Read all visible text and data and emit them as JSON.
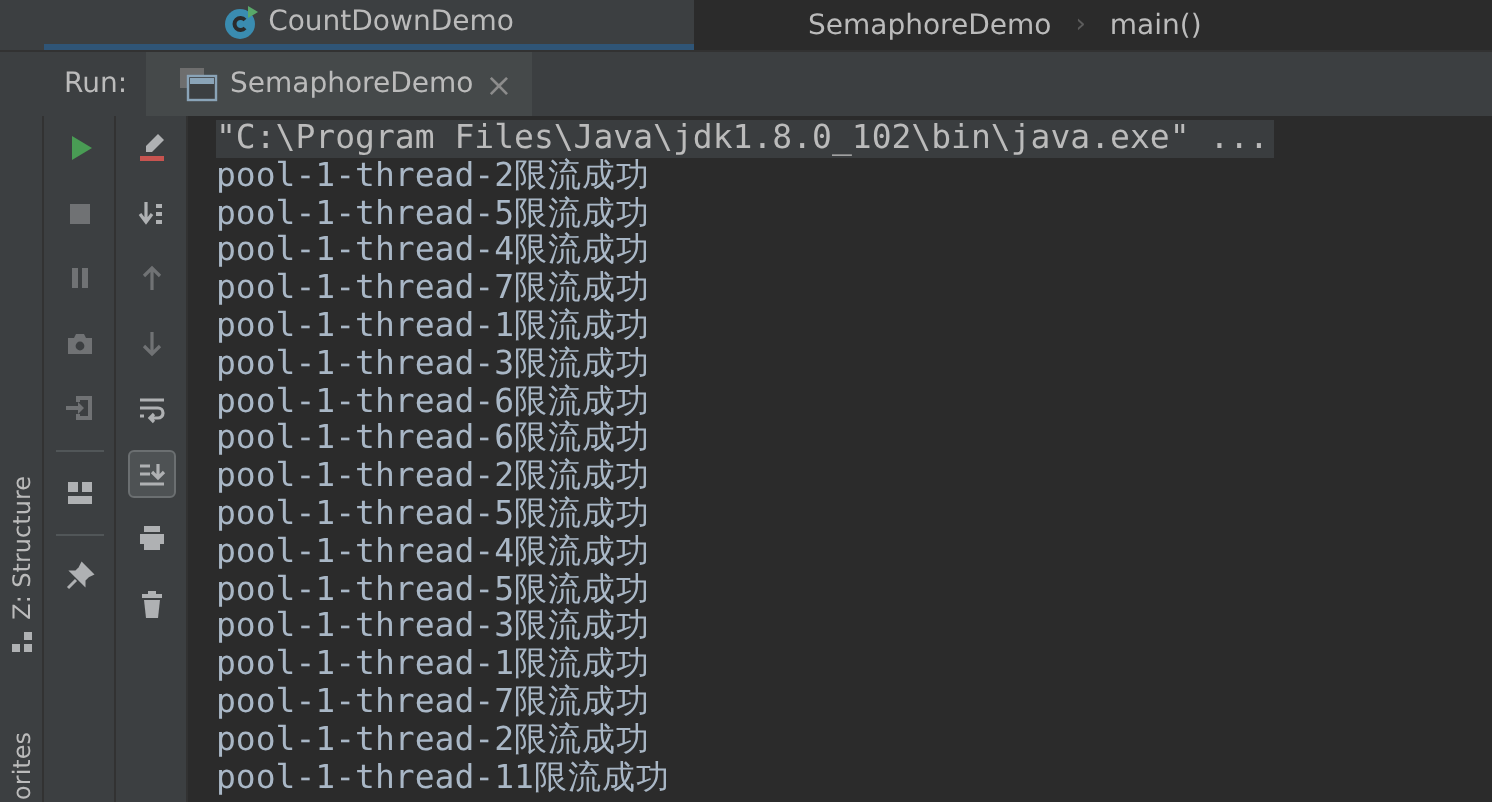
{
  "editor_tabs": [
    {
      "label": "CountDownDemo",
      "selected": true
    }
  ],
  "breadcrumb": [
    "SemaphoreDemo",
    "main()"
  ],
  "breadcrumb_separator": "›",
  "run_panel": {
    "label": "Run:",
    "tab": {
      "label": "SemaphoreDemo",
      "close": "×"
    }
  },
  "side_strip": [
    "Z: Structure",
    "orites"
  ],
  "toolbar_left": [
    {
      "kind": "run",
      "disabled": false
    },
    {
      "kind": "stop",
      "disabled": true
    },
    {
      "kind": "pause",
      "disabled": true
    },
    {
      "kind": "camera",
      "disabled": true
    },
    {
      "kind": "exit",
      "disabled": true
    },
    {
      "kind": "layout",
      "disabled": false
    },
    {
      "kind": "pin",
      "disabled": false
    }
  ],
  "toolbar_right": [
    {
      "kind": "clear",
      "on": false,
      "disabled": false
    },
    {
      "kind": "sort",
      "on": false,
      "disabled": false
    },
    {
      "kind": "up",
      "on": false,
      "disabled": true
    },
    {
      "kind": "down",
      "on": false,
      "disabled": true
    },
    {
      "kind": "wrap",
      "on": false,
      "disabled": false
    },
    {
      "kind": "scroll-end",
      "on": true,
      "disabled": false
    },
    {
      "kind": "print",
      "on": false,
      "disabled": false
    },
    {
      "kind": "trash",
      "on": false,
      "disabled": false
    }
  ],
  "console": {
    "command": "\"C:\\Program Files\\Java\\jdk1.8.0_102\\bin\\java.exe\" ...",
    "lines": [
      "pool-1-thread-2限流成功",
      "pool-1-thread-5限流成功",
      "pool-1-thread-4限流成功",
      "pool-1-thread-7限流成功",
      "pool-1-thread-1限流成功",
      "pool-1-thread-3限流成功",
      "pool-1-thread-6限流成功",
      "pool-1-thread-6限流成功",
      "pool-1-thread-2限流成功",
      "pool-1-thread-5限流成功",
      "pool-1-thread-4限流成功",
      "pool-1-thread-5限流成功",
      "pool-1-thread-3限流成功",
      "pool-1-thread-1限流成功",
      "pool-1-thread-7限流成功",
      "pool-1-thread-2限流成功",
      "pool-1-thread-11限流成功"
    ]
  }
}
